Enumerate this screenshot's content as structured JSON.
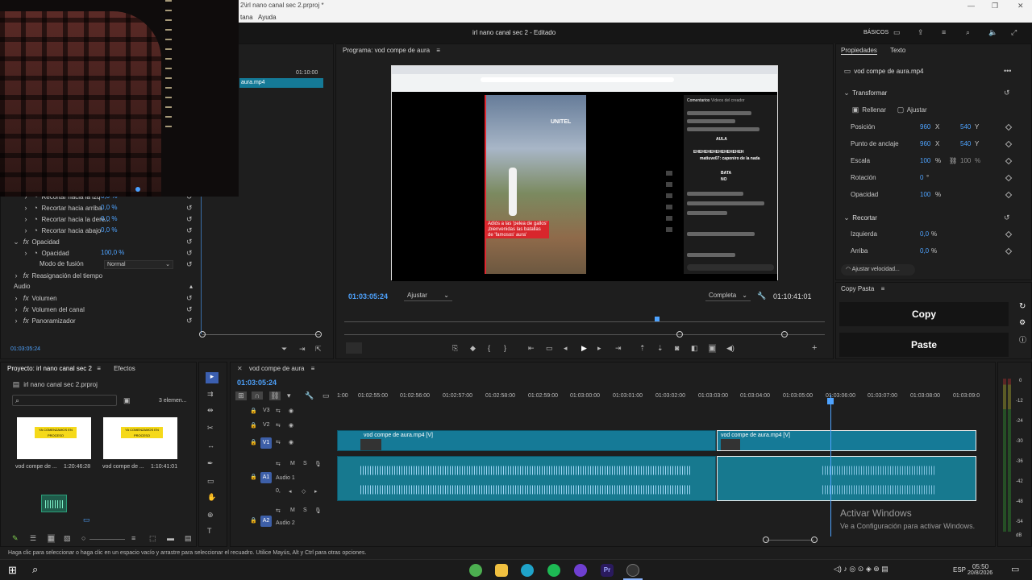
{
  "window": {
    "title": "2\\irl nano canal sec 2.prproj *",
    "menu": [
      "tana",
      "Ayuda"
    ],
    "project_title": "irl nano canal sec 2 - Editado",
    "workspace_label": "BÁSICOS"
  },
  "source_panel": {
    "timecode_right": "01:10:00",
    "clip_name": "aura.mp4",
    "effects": [
      {
        "label": "Recortar hacia la izq",
        "value": "0,0 %"
      },
      {
        "label": "Recortar hacia arriba",
        "value": "0,0 %"
      },
      {
        "label": "Recortar hacia la dere...",
        "value": "0,0 %"
      },
      {
        "label": "Recortar hacia abajo",
        "value": "0,0 %"
      }
    ],
    "opacity_group": "Opacidad",
    "opacity_label": "Opacidad",
    "opacity_value": "100,0 %",
    "blend_label": "Modo de fusión",
    "blend_value": "Normal",
    "time_remap": "Reasignación del tiempo",
    "audio_header": "Audio",
    "audio_effects": [
      "Volumen",
      "Volumen del canal",
      "Panoramizador"
    ],
    "timecode": "01:03:05:24"
  },
  "program": {
    "tab": "Programa: vod compe de aura",
    "timecode": "01:03:05:24",
    "fit": "Ajustar",
    "quality": "Completa",
    "duration": "01:10:41:01",
    "overlay_brand": "UNITEL",
    "overlay_caption": "Adiós a las 'pelea de gallos' ¡bienvenidas las batallas de 'famosos' aura'",
    "chat_tab1": "Comentarios",
    "chat_tab2": "Videos del creador",
    "chat_lines": [
      "AULA",
      "EHEHEHEHEHEHEHEHEH",
      "matiuve07: caponiro de la nada",
      "BATA",
      "NO"
    ]
  },
  "properties": {
    "tab1": "Propiedades",
    "tab2": "Texto",
    "clip": "vod compe de aura.mp4",
    "transform_header": "Transformar",
    "fill": "Rellenar",
    "fit": "Ajustar",
    "rows": [
      {
        "label": "Posición",
        "x": "960",
        "xu": "X",
        "y": "540",
        "yu": "Y"
      },
      {
        "label": "Punto de anclaje",
        "x": "960",
        "xu": "X",
        "y": "540",
        "yu": "Y"
      },
      {
        "label": "Escala",
        "x": "100",
        "xu": "%",
        "y": "100",
        "yu": "%"
      },
      {
        "label": "Rotación",
        "x": "0",
        "xu": "°",
        "y": "",
        "yu": ""
      },
      {
        "label": "Opacidad",
        "x": "100",
        "xu": "%",
        "y": "",
        "yu": ""
      }
    ],
    "crop_header": "Recortar",
    "crop_rows": [
      {
        "label": "Izquierda",
        "value": "0,0",
        "unit": "%"
      },
      {
        "label": "Arriba",
        "value": "0,0",
        "unit": "%"
      }
    ],
    "speed_button": "Ajustar velocidad..."
  },
  "copy_paste": {
    "tab": "Copy Pasta",
    "copy": "Copy",
    "paste": "Paste"
  },
  "project": {
    "tab1": "Proyecto: irl nano canal sec 2",
    "tab2": "Efectos",
    "file": "irl nano canal sec 2.prproj",
    "count": "3 elemen...",
    "items": [
      {
        "name": "vod compe de ...",
        "duration": "1:20:46:28",
        "thumb_text": "YA COMENZAMOS EN PROCESO"
      },
      {
        "name": "vod compe de ...",
        "duration": "1:10:41:01",
        "thumb_text": "YA COMENZAMOS EN PROCESO"
      }
    ]
  },
  "timeline": {
    "tab": "vod compe de aura",
    "timecode": "01:03:05:24",
    "ruler": [
      "1:00",
      "01:02:55:00",
      "01:02:56:00",
      "01:02:57:00",
      "01:02:58:00",
      "01:02:59:00",
      "01:03:00:00",
      "01:03:01:00",
      "01:03:02:00",
      "01:03:03:00",
      "01:03:04:00",
      "01:03:05:00",
      "01:03:06:00",
      "01:03:07:00",
      "01:03:08:00",
      "01:03:09:0"
    ],
    "tracks": {
      "v3": "V3",
      "v2": "V2",
      "v1": "V1",
      "a1": "A1",
      "a1_name": "Audio 1",
      "a2": "A2",
      "a2_name": "Audio 2"
    },
    "clip1": "vod compe de aura.mp4 [V]",
    "clip2": "vod compe de aura.mp4 [V]"
  },
  "meter": {
    "labels": [
      "0",
      "-12",
      "-24",
      "-30",
      "-36",
      "-42",
      "-48",
      "-54",
      "dB"
    ]
  },
  "watermark": {
    "title": "Activar Windows",
    "subtitle": "Ve a Configuración para activar Windows."
  },
  "status": "Haga clic para seleccionar o haga clic en un espacio vacío y arrastre para seleccionar el recuadro. Utilice Mayús, Alt y Ctrl para otras opciones.",
  "taskbar": {
    "lang": "ESP",
    "time": "05:50",
    "date": "20/8/2026",
    "colors": {
      "chrome": "#4caf50",
      "files": "#f0c040",
      "edge": "#1fa3c9",
      "spotify": "#1db954",
      "discord": "#6f3fd1",
      "premiere": "#2a1a5e"
    }
  }
}
